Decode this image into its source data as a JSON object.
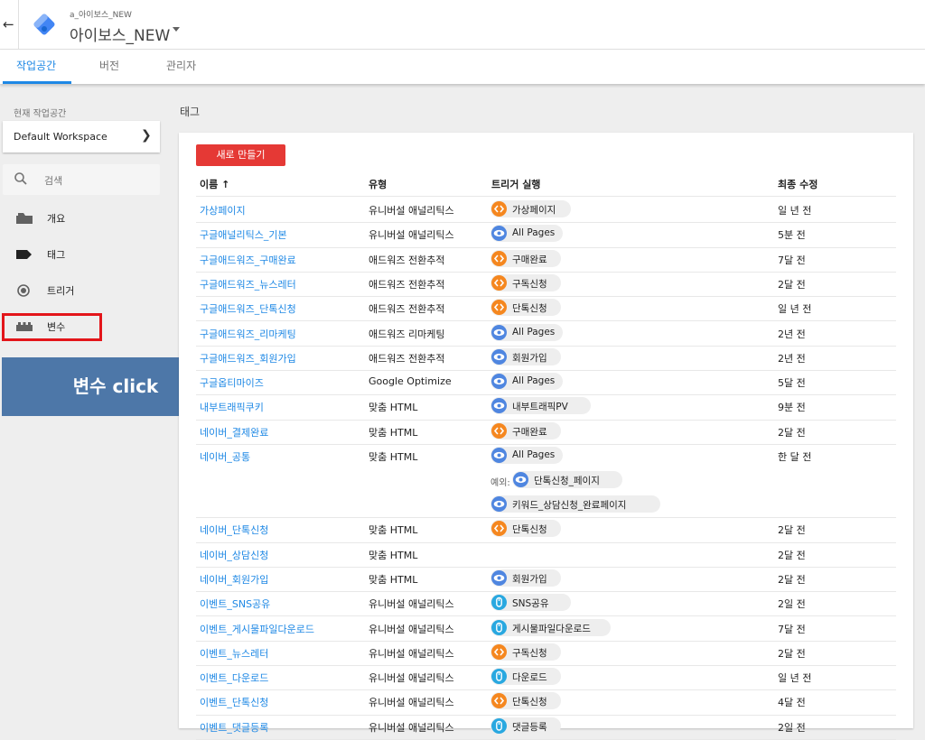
{
  "header": {
    "account": "a_아이보스_NEW",
    "container": "아이보스_NEW"
  },
  "tabs": [
    {
      "label": "작업공간"
    },
    {
      "label": "버전"
    },
    {
      "label": "관리자"
    }
  ],
  "sidebar": {
    "workspace_label": "현재 작업공간",
    "workspace_name": "Default Workspace",
    "search_label": "검색",
    "items": [
      {
        "label": "개요",
        "icon": "overview-icon"
      },
      {
        "label": "태그",
        "icon": "tag-icon"
      },
      {
        "label": "트리거",
        "icon": "trigger-icon"
      },
      {
        "label": "변수",
        "icon": "variable-icon"
      }
    ]
  },
  "callout": "변수 click",
  "main": {
    "title": "태그",
    "new_button": "새로 만들기",
    "columns": [
      "이름 ↑",
      "유형",
      "트리거 실행",
      "최종 수정"
    ],
    "exception_label": "예외:",
    "rows": [
      {
        "name": "가상페이지",
        "type": "유니버설 애널리틱스",
        "triggers": [
          {
            "label": "가상페이지",
            "kind": "custom"
          }
        ],
        "modified": "일 년 전"
      },
      {
        "name": "구글애널리틱스_기본",
        "type": "유니버설 애널리틱스",
        "triggers": [
          {
            "label": "All Pages",
            "kind": "pageview"
          }
        ],
        "modified": "5분 전"
      },
      {
        "name": "구글애드워즈_구매완료",
        "type": "애드워즈 전환추적",
        "triggers": [
          {
            "label": "구매완료",
            "kind": "custom"
          }
        ],
        "modified": "7달 전"
      },
      {
        "name": "구글애드워즈_뉴스레터",
        "type": "애드워즈 전환추적",
        "triggers": [
          {
            "label": "구독신청",
            "kind": "custom"
          }
        ],
        "modified": "2달 전"
      },
      {
        "name": "구글애드워즈_단톡신청",
        "type": "애드워즈 전환추적",
        "triggers": [
          {
            "label": "단톡신청",
            "kind": "custom"
          }
        ],
        "modified": "일 년 전"
      },
      {
        "name": "구글애드워즈_리마케팅",
        "type": "애드워즈 리마케팅",
        "triggers": [
          {
            "label": "All Pages",
            "kind": "pageview"
          }
        ],
        "modified": "2년 전"
      },
      {
        "name": "구글애드워즈_회원가입",
        "type": "애드워즈 전환추적",
        "triggers": [
          {
            "label": "회원가입",
            "kind": "pageview"
          }
        ],
        "modified": "2년 전"
      },
      {
        "name": "구글옵티마이즈",
        "type": "Google Optimize",
        "triggers": [
          {
            "label": "All Pages",
            "kind": "pageview"
          }
        ],
        "modified": "5달 전"
      },
      {
        "name": "내부트래픽쿠키",
        "type": "맞춤 HTML",
        "triggers": [
          {
            "label": "내부트래픽PV",
            "kind": "pageview"
          }
        ],
        "modified": "9분 전"
      },
      {
        "name": "네이버_결제완료",
        "type": "맞춤 HTML",
        "triggers": [
          {
            "label": "구매완료",
            "kind": "custom"
          }
        ],
        "modified": "2달 전"
      },
      {
        "name": "네이버_공통",
        "type": "맞춤 HTML",
        "triggers": [
          {
            "label": "All Pages",
            "kind": "pageview"
          }
        ],
        "exceptions": [
          {
            "label": "단톡신청_페이지",
            "kind": "pageview"
          },
          {
            "label": "키워드_상담신청_완료페이지",
            "kind": "pageview"
          }
        ],
        "modified": "한 달 전"
      },
      {
        "name": "네이버_단톡신청",
        "type": "맞춤 HTML",
        "triggers": [
          {
            "label": "단톡신청",
            "kind": "custom"
          }
        ],
        "modified": "2달 전"
      },
      {
        "name": "네이버_상담신청",
        "type": "맞춤 HTML",
        "triggers": [],
        "modified": "2달 전"
      },
      {
        "name": "네이버_회원가입",
        "type": "맞춤 HTML",
        "triggers": [
          {
            "label": "회원가입",
            "kind": "pageview"
          }
        ],
        "modified": "2달 전"
      },
      {
        "name": "이벤트_SNS공유",
        "type": "유니버설 애널리틱스",
        "triggers": [
          {
            "label": "SNS공유",
            "kind": "click"
          }
        ],
        "modified": "2일 전"
      },
      {
        "name": "이벤트_게시물파일다운로드",
        "type": "유니버설 애널리틱스",
        "triggers": [
          {
            "label": "게시물파일다운로드",
            "kind": "click"
          }
        ],
        "modified": "7달 전"
      },
      {
        "name": "이벤트_뉴스레터",
        "type": "유니버설 애널리틱스",
        "triggers": [
          {
            "label": "구독신청",
            "kind": "custom"
          }
        ],
        "modified": "2달 전"
      },
      {
        "name": "이벤트_다운로드",
        "type": "유니버설 애널리틱스",
        "triggers": [
          {
            "label": "다운로드",
            "kind": "click"
          }
        ],
        "modified": "일 년 전"
      },
      {
        "name": "이벤트_단톡신청",
        "type": "유니버설 애널리틱스",
        "triggers": [
          {
            "label": "단톡신청",
            "kind": "custom"
          }
        ],
        "modified": "4달 전"
      },
      {
        "name": "이벤트_댓글등록",
        "type": "유니버설 애널리틱스",
        "triggers": [
          {
            "label": "댓글등록",
            "kind": "click"
          }
        ],
        "modified": "2일 전"
      }
    ]
  }
}
